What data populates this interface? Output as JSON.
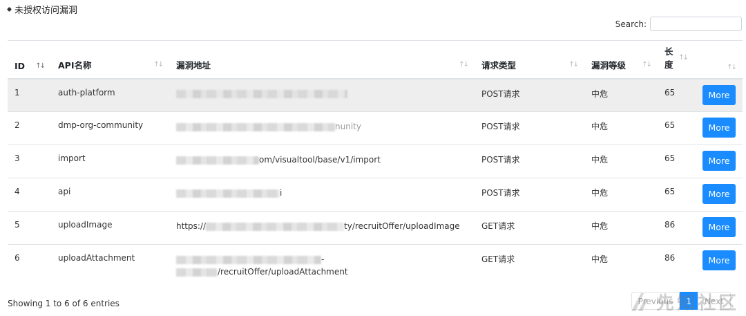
{
  "section": {
    "title": "未授权访问漏洞"
  },
  "search": {
    "label": "Search:",
    "value": "",
    "placeholder": ""
  },
  "table": {
    "headers": {
      "id": "ID",
      "name": "API名称",
      "url": "漏洞地址",
      "method": "请求类型",
      "level": "漏洞等级",
      "length": "长度",
      "action": ""
    },
    "rows": [
      {
        "id": "1",
        "name": "auth-platform",
        "url_visible": "",
        "url_visible2": "",
        "method": "POST请求",
        "level": "中危",
        "length": "65",
        "action": "More"
      },
      {
        "id": "2",
        "name": "dmp-org-community",
        "url_visible": "",
        "url_visible2": "nunity",
        "method": "POST请求",
        "level": "中危",
        "length": "65",
        "action": "More"
      },
      {
        "id": "3",
        "name": "import",
        "url_visible": "",
        "url_visible2": "om/visualtool/base/v1/import",
        "method": "POST请求",
        "level": "中危",
        "length": "65",
        "action": "More"
      },
      {
        "id": "4",
        "name": "api",
        "url_visible": "",
        "url_visible2": "i",
        "method": "POST请求",
        "level": "中危",
        "length": "65",
        "action": "More"
      },
      {
        "id": "5",
        "name": "uploadImage",
        "url_visible": "https://",
        "url_visible2": "ty/recruitOffer/uploadImage",
        "method": "GET请求",
        "level": "中危",
        "length": "86",
        "action": "More"
      },
      {
        "id": "6",
        "name": "uploadAttachment",
        "url_visible": "",
        "url_visible2": "-",
        "url_line2": "/recruitOffer/uploadAttachment",
        "method": "GET请求",
        "level": "中危",
        "length": "86",
        "action": "More"
      }
    ]
  },
  "footer": {
    "info": "Showing 1 to 6 of 6 entries",
    "prev": "Previous",
    "current_page": "1",
    "next": "Next"
  },
  "watermark": {
    "text": "先知社区"
  },
  "colors": {
    "primary": "#1a8cff",
    "selected_row": "#eeeeee",
    "border": "#dee2e6"
  }
}
